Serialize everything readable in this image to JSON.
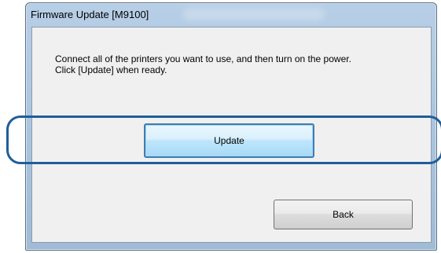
{
  "window": {
    "title": "Firmware Update [M9100]"
  },
  "message": {
    "line1": "Connect all of the printers you want to use, and then turn on the power.",
    "line2": "Click [Update] when ready."
  },
  "buttons": {
    "update_label": "Update",
    "back_label": "Back"
  },
  "colors": {
    "highlight": "#1f5e99",
    "titlebar": "#b7cfe6",
    "client_bg": "#f0f0f0"
  }
}
